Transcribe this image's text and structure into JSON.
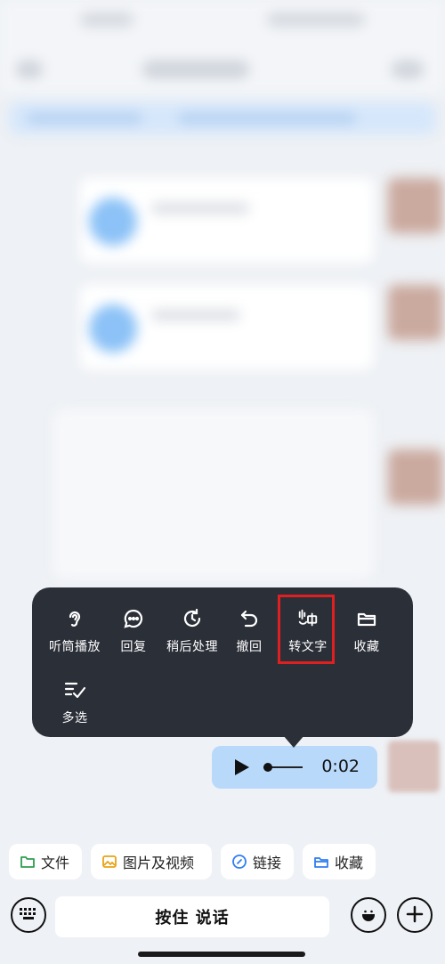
{
  "menu": {
    "items": [
      {
        "label": "听筒播放",
        "icon": "ear-icon"
      },
      {
        "label": "回复",
        "icon": "reply-bubble-icon"
      },
      {
        "label": "稍后处理",
        "icon": "clock-later-icon"
      },
      {
        "label": "撤回",
        "icon": "undo-icon"
      },
      {
        "label": "转文字",
        "icon": "speech-to-text-icon"
      },
      {
        "label": "收藏",
        "icon": "folder-icon"
      },
      {
        "label": "多选",
        "icon": "multi-select-icon"
      }
    ],
    "highlighted": "转文字"
  },
  "voice_message": {
    "duration": "0:02",
    "icon": "play-icon"
  },
  "quick_actions": [
    {
      "label": "文件",
      "icon": "folder-icon",
      "color": "#2e9e4f"
    },
    {
      "label": "图片及视频",
      "icon": "image-icon",
      "color": "#e8a317"
    },
    {
      "label": "链接",
      "icon": "link-icon",
      "color": "#2f7ff0"
    },
    {
      "label": "收藏",
      "icon": "favorite-box-icon",
      "color": "#2f7ff0"
    }
  ],
  "input_bar": {
    "talk_label": "按住 说话",
    "left_icon": "keyboard-icon",
    "emoji_icon": "emoji-icon",
    "plus_icon": "plus-icon"
  },
  "colors": {
    "menu_bg": "#2b2f38",
    "voice_bubble": "#b9d9fb",
    "highlight": "#e02020",
    "background": "#eef1f5"
  }
}
